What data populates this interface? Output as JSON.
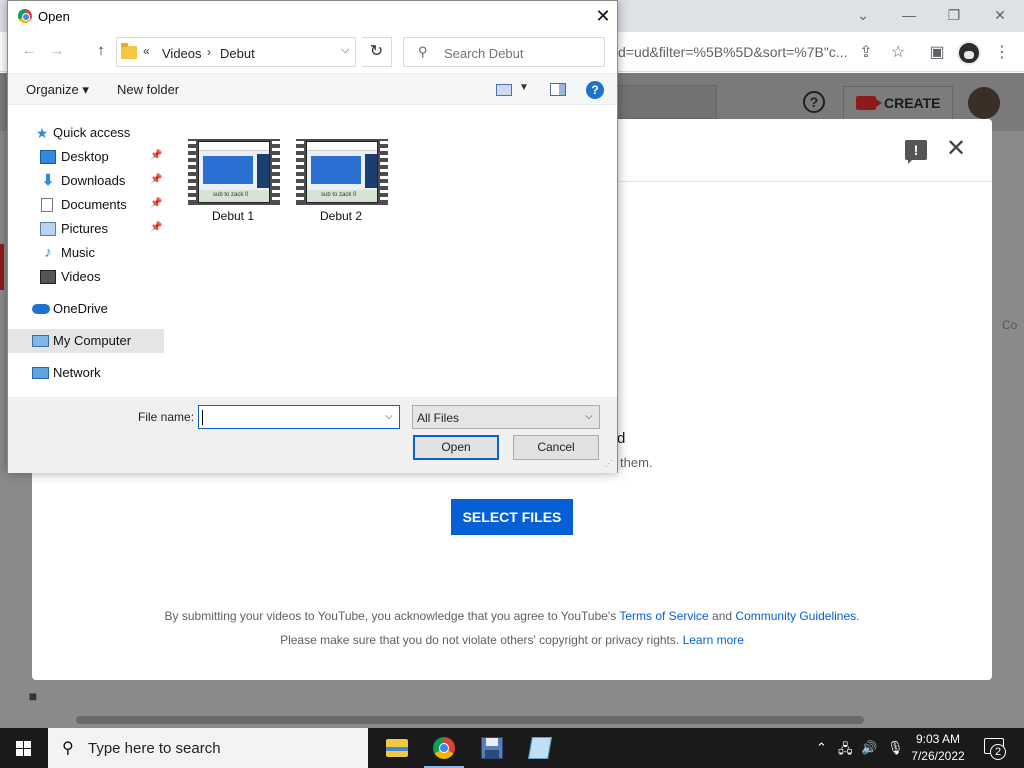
{
  "browser": {
    "url_visible": "d=ud&filter=%5B%5D&sort=%7B\"c...",
    "minimize_icon": "chevron-down-icon"
  },
  "youtube": {
    "create_label": "CREATE",
    "side_text": "Co",
    "drag_text_partial": "d",
    "drag_sub_partial": "them.",
    "select_files_label": "SELECT FILES",
    "legal_1_prefix": "By submitting your videos to YouTube, you acknowledge that you agree to YouTube's ",
    "terms_link": "Terms of Service",
    "legal_1_and": " and ",
    "guidelines_link": "Community Guidelines",
    "legal_1_suffix": ".",
    "legal_2_prefix": "Please make sure that you do not violate others' copyright or privacy rights. ",
    "learn_more_link": "Learn more",
    "accent_color": "#065fd4"
  },
  "dialog": {
    "title": "Open",
    "breadcrumb": {
      "chevrons": "«",
      "items": [
        "Videos",
        "Debut"
      ],
      "separator": "›"
    },
    "search_placeholder": "Search Debut",
    "toolbar": {
      "organize_label": "Organize ▾",
      "new_folder_label": "New folder",
      "help_label": "?"
    },
    "nav": {
      "quick_access": "Quick access",
      "desktop": "Desktop",
      "downloads": "Downloads",
      "documents": "Documents",
      "pictures": "Pictures",
      "music": "Music",
      "videos": "Videos",
      "onedrive": "OneDrive",
      "my_computer": "My Computer",
      "network": "Network"
    },
    "files": [
      {
        "name": "Debut 1",
        "thumb_caption": "sub to zack 0"
      },
      {
        "name": "Debut 2",
        "thumb_caption": "sub to zack 0"
      }
    ],
    "filename_label": "File name:",
    "filename_value": "",
    "filetype_value": "All Files",
    "open_label": "Open",
    "cancel_label": "Cancel"
  },
  "taskbar": {
    "search_placeholder": "Type here to search",
    "time": "9:03 AM",
    "date": "7/26/2022",
    "notification_count": "2"
  }
}
